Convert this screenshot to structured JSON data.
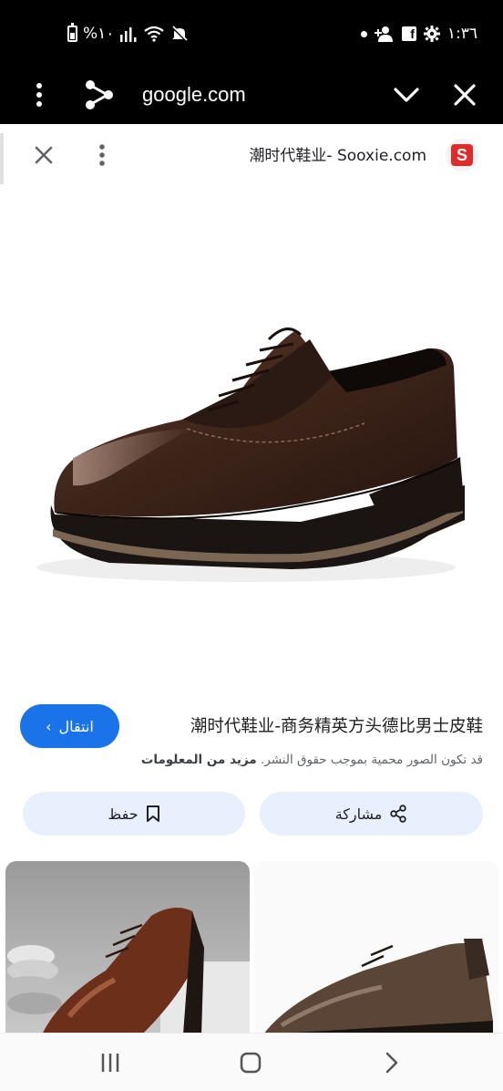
{
  "status_bar": {
    "battery_text": "%١٠",
    "time": "١:٣٦"
  },
  "toolbar": {
    "url": "google.com"
  },
  "viewer": {
    "source_title": "潮时代鞋业- Sooxie.com",
    "favicon_letter": "S"
  },
  "info": {
    "visit_label": "انتقال",
    "title": "潮时代鞋业-商务精英方头德比男士皮鞋",
    "copyright_text": "قد تكون الصور محمية بموجب حقوق النشر.",
    "learn_more": "مزيد من المعلومات",
    "share_label": "مشاركة",
    "save_label": "حفظ"
  },
  "colors": {
    "accent": "#1a73e8",
    "action_bg": "#e8f0fe",
    "favicon_red": "#e12a2a"
  }
}
